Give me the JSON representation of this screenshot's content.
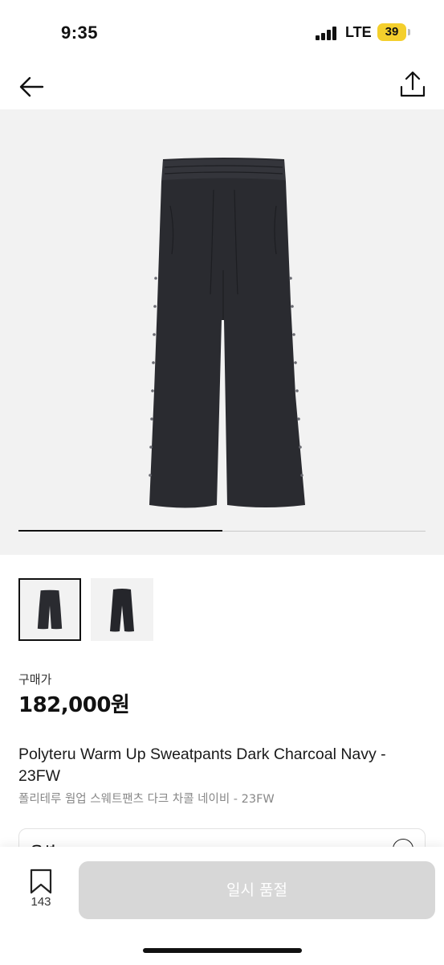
{
  "status_bar": {
    "time": "9:35",
    "network": "LTE",
    "battery": "39"
  },
  "nav": {
    "back_icon": "arrow-left-icon",
    "share_icon": "share-upload-icon"
  },
  "gallery": {
    "image_count": 2,
    "current_index": 1,
    "progress": 0.5
  },
  "product": {
    "price_label": "구매가",
    "price": "182,000원",
    "title_en": "Polyteru Warm Up Sweatpants Dark Charcoal Navy - 23FW",
    "title_ko": "폴리테루 웜업 스웨트팬츠 다크 차콜 네이비 - 23FW"
  },
  "option": {
    "label": "옵션",
    "icon": "chevron-down-icon"
  },
  "bottom_bar": {
    "bookmark_icon": "bookmark-icon",
    "bookmark_count": "143",
    "soldout_label": "일시 품절"
  },
  "colors": {
    "pants": "#2a2b30",
    "button_disabled": "#d7d7d7",
    "hero_bg": "#f2f2f2"
  }
}
